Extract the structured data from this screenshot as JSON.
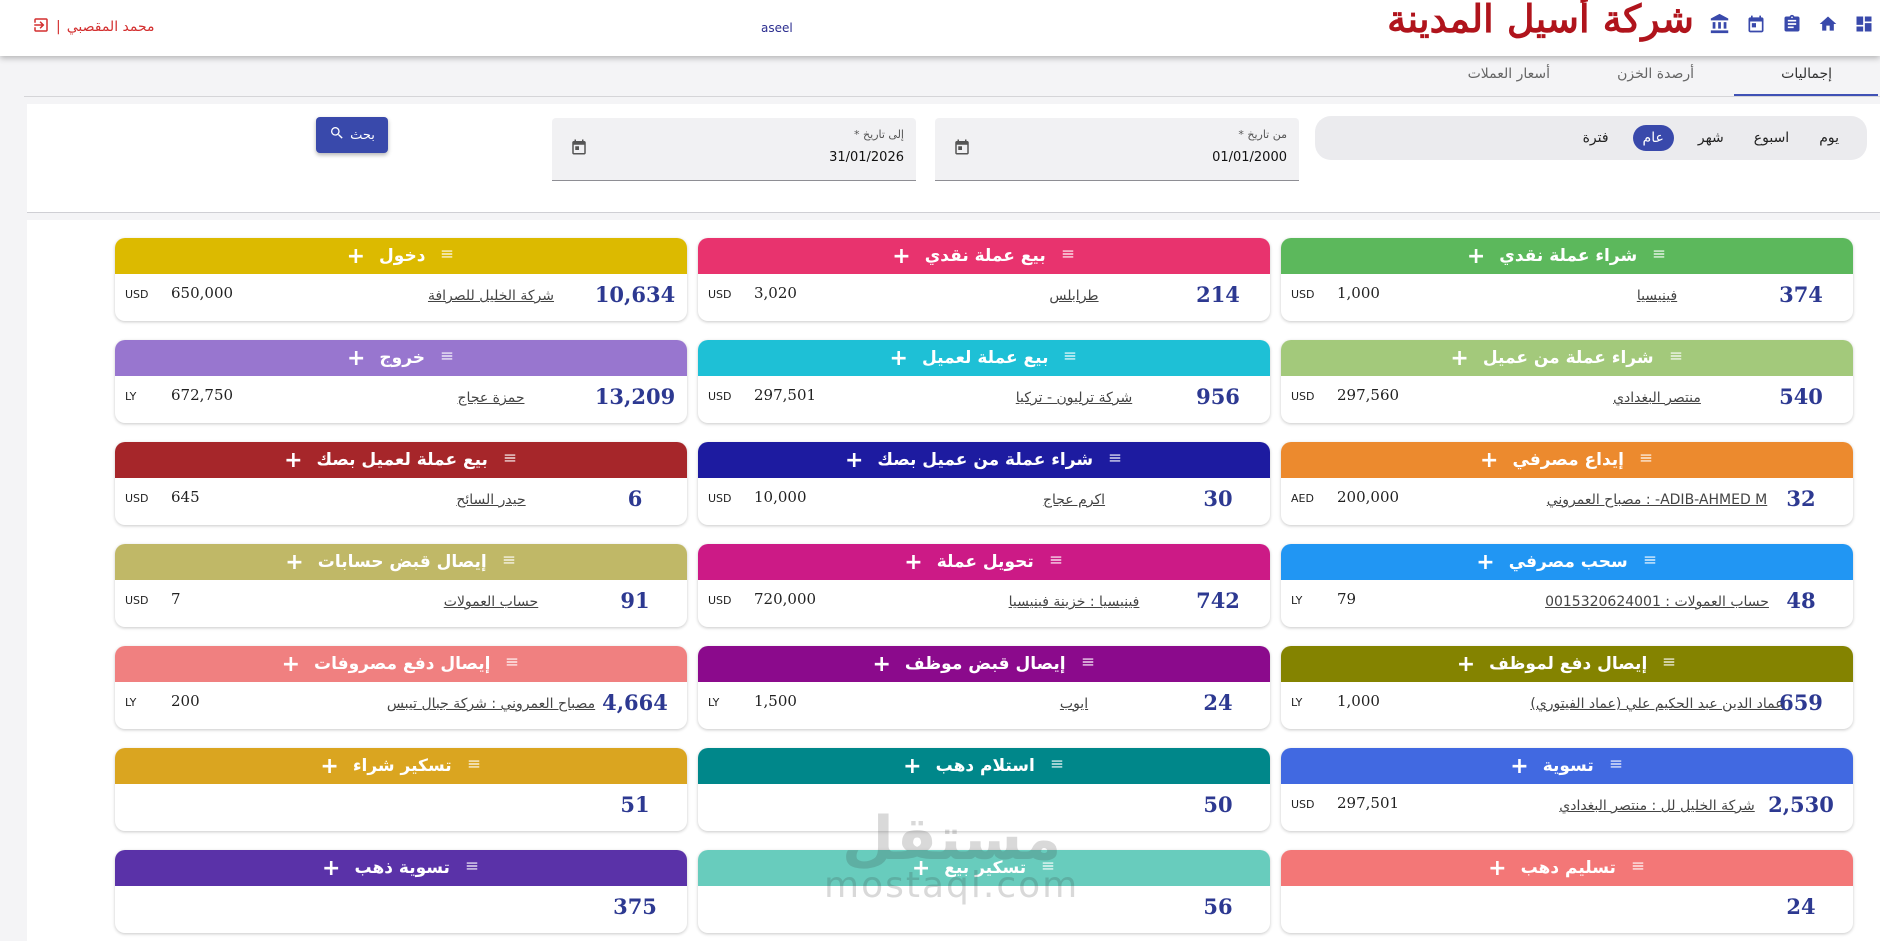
{
  "app": {
    "brand_title": "شركة أسيل المدينة",
    "company_code": "aseel",
    "user_name": "محمد المقصبي",
    "nav_icons": [
      "dashboard-icon",
      "home-icon",
      "clipboard-icon",
      "calendar-icon",
      "bank-icon"
    ]
  },
  "tabs": [
    {
      "label": "إجماليات",
      "active": true
    },
    {
      "label": "أرصدة الخزن",
      "active": false
    },
    {
      "label": "أسعار العملات",
      "active": false
    }
  ],
  "filter": {
    "periods": [
      {
        "label": "يوم",
        "selected": false
      },
      {
        "label": "اسبوع",
        "selected": false
      },
      {
        "label": "شهر",
        "selected": false
      },
      {
        "label": "عام",
        "selected": true
      },
      {
        "label": "فترة",
        "selected": false
      }
    ],
    "from_label": "من تاريخ *",
    "from_value": "01/01/2000",
    "to_label": "إلى تاريخ *",
    "to_value": "31/01/2026",
    "search_label": "بحث"
  },
  "cards": [
    {
      "title": "شراء عملة نقدي",
      "color": "#5cb85c",
      "count": "374",
      "party": "فينيسيا",
      "amount": "1,000",
      "currency": "USD"
    },
    {
      "title": "بيع عملة نقدي",
      "color": "#e8336e",
      "count": "214",
      "party": "طرابلس",
      "amount": "3,020",
      "currency": "USD"
    },
    {
      "title": "دخول",
      "color": "#dcba00",
      "count": "10,634",
      "party": "شركة الخليل للصرافة",
      "amount": "650,000",
      "currency": "USD"
    },
    {
      "title": "شراء عملة من عميل",
      "color": "#a3c97b",
      "count": "540",
      "party": "منتصر البغدادي",
      "amount": "297,560",
      "currency": "USD"
    },
    {
      "title": "بيع عملة لعميل",
      "color": "#1ec0d6",
      "count": "956",
      "party": "شركة ترليون - تركيا",
      "amount": "297,501",
      "currency": "USD"
    },
    {
      "title": "خروج",
      "color": "#9876cf",
      "count": "13,209",
      "party": "حمزة عجاج",
      "amount": "672,750",
      "currency": "LY"
    },
    {
      "title": "إيداع مصرفي",
      "color": "#ec8a2e",
      "count": "32",
      "party": "ADIB-AHMED M- : مصباح العمروني",
      "amount": "200,000",
      "currency": "AED"
    },
    {
      "title": "شراء عملة من عميل بصك",
      "color": "#1d1ba0",
      "count": "30",
      "party": "اكرم عجاج",
      "amount": "10,000",
      "currency": "USD"
    },
    {
      "title": "بيع عملة لعميل بصك",
      "color": "#a6262a",
      "count": "6",
      "party": "حيدر السائح",
      "amount": "645",
      "currency": "USD"
    },
    {
      "title": "سحب مصرفي",
      "color": "#2196f3",
      "count": "48",
      "party": "حساب العمولات : 0015320624001",
      "amount": "79",
      "currency": "LY"
    },
    {
      "title": "تحويل عملة",
      "color": "#cc1a86",
      "count": "742",
      "party": "فينيسيا : خزينة فينيسيا",
      "amount": "720,000",
      "currency": "USD"
    },
    {
      "title": "إيصال قبض حسابات",
      "color": "#c0b867",
      "count": "91",
      "party": "حساب العمولات",
      "amount": "7",
      "currency": "USD"
    },
    {
      "title": "إيصال دفع لموظف",
      "color": "#848300",
      "count": "659",
      "party": "عماد الدين عبد الحكيم علي (عماد الفيتوري)",
      "amount": "1,000",
      "currency": "LY"
    },
    {
      "title": "إيصال قبض موظف",
      "color": "#8b0a8c",
      "count": "24",
      "party": "ايوب",
      "amount": "1,500",
      "currency": "LY"
    },
    {
      "title": "إيصال دفع مصروفات",
      "color": "#f08080",
      "count": "4,664",
      "party": "مصباح العمروني : شركة جبال تيبس",
      "amount": "200",
      "currency": "LY"
    },
    {
      "title": "تسوية",
      "color": "#4169e1",
      "count": "2,530",
      "party": "شركة الخليل لل : منتصر البغدادي",
      "amount": "297,501",
      "currency": "USD"
    },
    {
      "title": "استلام دهب",
      "color": "#00878a",
      "count": "50",
      "party": "",
      "amount": "",
      "currency": ""
    },
    {
      "title": "تسكير شراء",
      "color": "#daa520",
      "count": "51",
      "party": "",
      "amount": "",
      "currency": ""
    },
    {
      "title": "تسليم دهب",
      "color": "#f37777",
      "count": "24",
      "party": "",
      "amount": "",
      "currency": ""
    },
    {
      "title": "تسكير بيع",
      "color": "#68ccbd",
      "count": "56",
      "party": "",
      "amount": "",
      "currency": ""
    },
    {
      "title": "تسوية ذهب",
      "color": "#5a32a8",
      "count": "375",
      "party": "",
      "amount": "",
      "currency": ""
    }
  ],
  "watermark": {
    "arabic": "مستقل",
    "latin": "mostaql.com"
  }
}
